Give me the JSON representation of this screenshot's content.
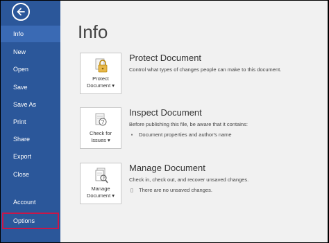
{
  "sidebar": {
    "back_icon": "arrow-left-icon",
    "items": [
      {
        "label": "Info"
      },
      {
        "label": "New"
      },
      {
        "label": "Open"
      },
      {
        "label": "Save"
      },
      {
        "label": "Save As"
      },
      {
        "label": "Print"
      },
      {
        "label": "Share"
      },
      {
        "label": "Export"
      },
      {
        "label": "Close"
      },
      {
        "label": "Account"
      },
      {
        "label": "Options"
      }
    ],
    "selected": "Info",
    "highlighted": "Options",
    "colors": {
      "background": "#2b579a",
      "selected": "#3a6ab4",
      "highlight_border": "#c8174a"
    }
  },
  "main": {
    "title": "Info",
    "sections": [
      {
        "tile_line1": "Protect",
        "tile_line2": "Document",
        "dropdown": "▾",
        "icon": "lock-icon",
        "title": "Protect Document",
        "description": "Control what types of changes people can make to this document."
      },
      {
        "tile_line1": "Check for",
        "tile_line2": "Issues",
        "dropdown": "▾",
        "icon": "inspect-document-icon",
        "title": "Inspect Document",
        "description": "Before publishing this file, be aware that it contains:",
        "bullet": "Document properties and author's name"
      },
      {
        "tile_line1": "Manage",
        "tile_line2": "Document",
        "dropdown": "▾",
        "icon": "manage-document-icon",
        "title": "Manage Document",
        "description": "Check in, check out, and recover unsaved changes.",
        "bullet": "There are no unsaved changes."
      }
    ]
  }
}
